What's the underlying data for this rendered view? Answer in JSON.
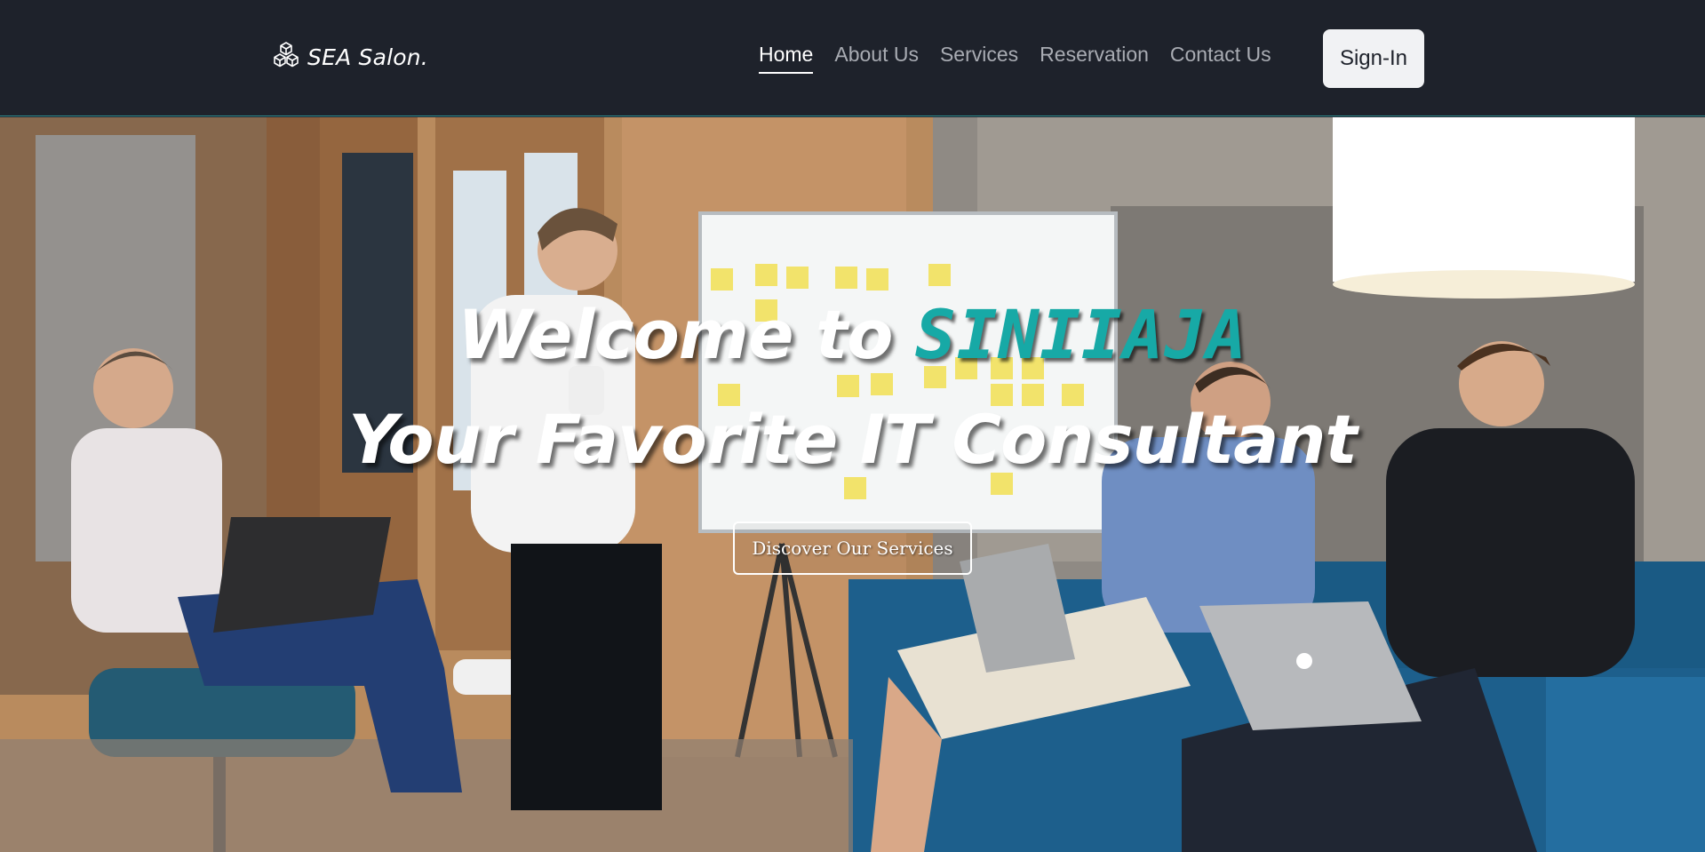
{
  "brand": {
    "name": "SEA Salon.",
    "icon": "boxes-icon"
  },
  "nav": {
    "items": [
      {
        "label": "Home",
        "active": true
      },
      {
        "label": "About Us",
        "active": false
      },
      {
        "label": "Services",
        "active": false
      },
      {
        "label": "Reservation",
        "active": false
      },
      {
        "label": "Contact Us",
        "active": false
      }
    ],
    "signin_label": "Sign-In"
  },
  "hero": {
    "title_prefix": "Welcome to ",
    "title_highlight": "SINIIAJA",
    "subtitle": "Your Favorite IT Consultant",
    "cta_label": "Discover Our Services"
  },
  "colors": {
    "navbar": "#1e222b",
    "accent": "#17a9a6",
    "signin_bg": "#f1f2f4"
  }
}
